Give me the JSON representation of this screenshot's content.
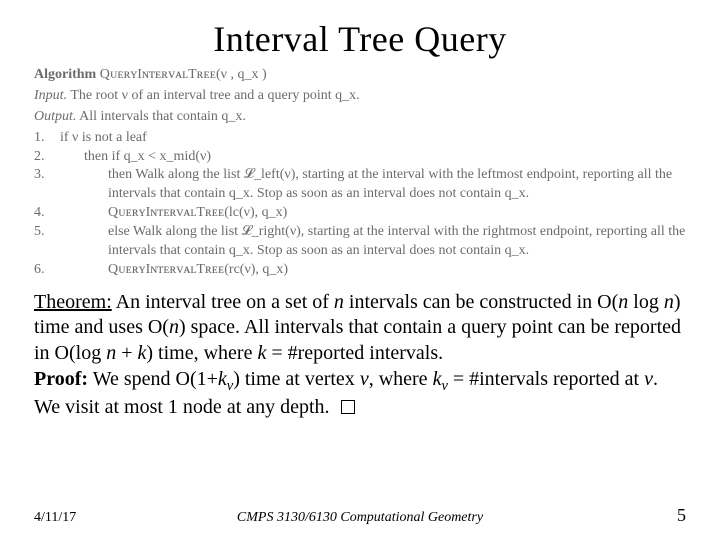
{
  "title": "Interval Tree Query",
  "algorithm": {
    "name_label": "Algorithm",
    "name": "QᴜᴇʀʏIɴᴛᴇʀᴠᴀʟTʀᴇᴇ(ν , q_x )",
    "input_label": "Input.",
    "input": "The root ν of an interval tree and a query point q_x.",
    "output_label": "Output.",
    "output": "All intervals that contain q_x.",
    "steps": [
      {
        "n": "1.",
        "indent": 0,
        "text": "if ν is not a leaf",
        "kw": "if"
      },
      {
        "n": "2.",
        "indent": 1,
        "text": "then if q_x < x_mid(ν)",
        "kw": "then if"
      },
      {
        "n": "3.",
        "indent": 2,
        "text": "then Walk along the list 𝓛_left(ν), starting at the interval with the leftmost endpoint, reporting all the intervals that contain q_x. Stop as soon as an interval does not contain q_x.",
        "kw": "then"
      },
      {
        "n": "4.",
        "indent": 2,
        "text": "QᴜᴇʀʏIɴᴛᴇʀᴠᴀʟTʀᴇᴇ(lc(ν), q_x)",
        "kw": ""
      },
      {
        "n": "5.",
        "indent": 2,
        "text": "else Walk along the list 𝓛_right(ν), starting at the interval with the rightmost endpoint, reporting all the intervals that contain q_x. Stop as soon as an interval does not contain q_x.",
        "kw": "else"
      },
      {
        "n": "6.",
        "indent": 2,
        "text": "QᴜᴇʀʏIɴᴛᴇʀᴠᴀʟTʀᴇᴇ(rc(ν), q_x)",
        "kw": ""
      }
    ]
  },
  "theorem": {
    "label": "Theorem:",
    "body_1": "An interval tree on a set of ",
    "n": "n",
    "body_2": " intervals can be constructed in O(",
    "body_2b": " log ",
    "body_3": ") time and uses O(",
    "body_4": ") space. All  intervals that contain a query point can be reported in O(log ",
    "body_5": " + ",
    "k": "k",
    "body_6": ")  time, where ",
    "body_7": " = #reported intervals.",
    "proof_label": "Proof:",
    "proof_1": " We spend O(1+",
    "kv": "k",
    "vsub": "v",
    "proof_2": ") time at vertex ",
    "v": "v",
    "proof_3": ", where ",
    "proof_4": " = #intervals reported at ",
    "proof_5": ". We visit at most 1 node at any depth."
  },
  "footer": {
    "date": "4/11/17",
    "course": "CMPS 3130/6130 Computational Geometry",
    "page": "5"
  }
}
